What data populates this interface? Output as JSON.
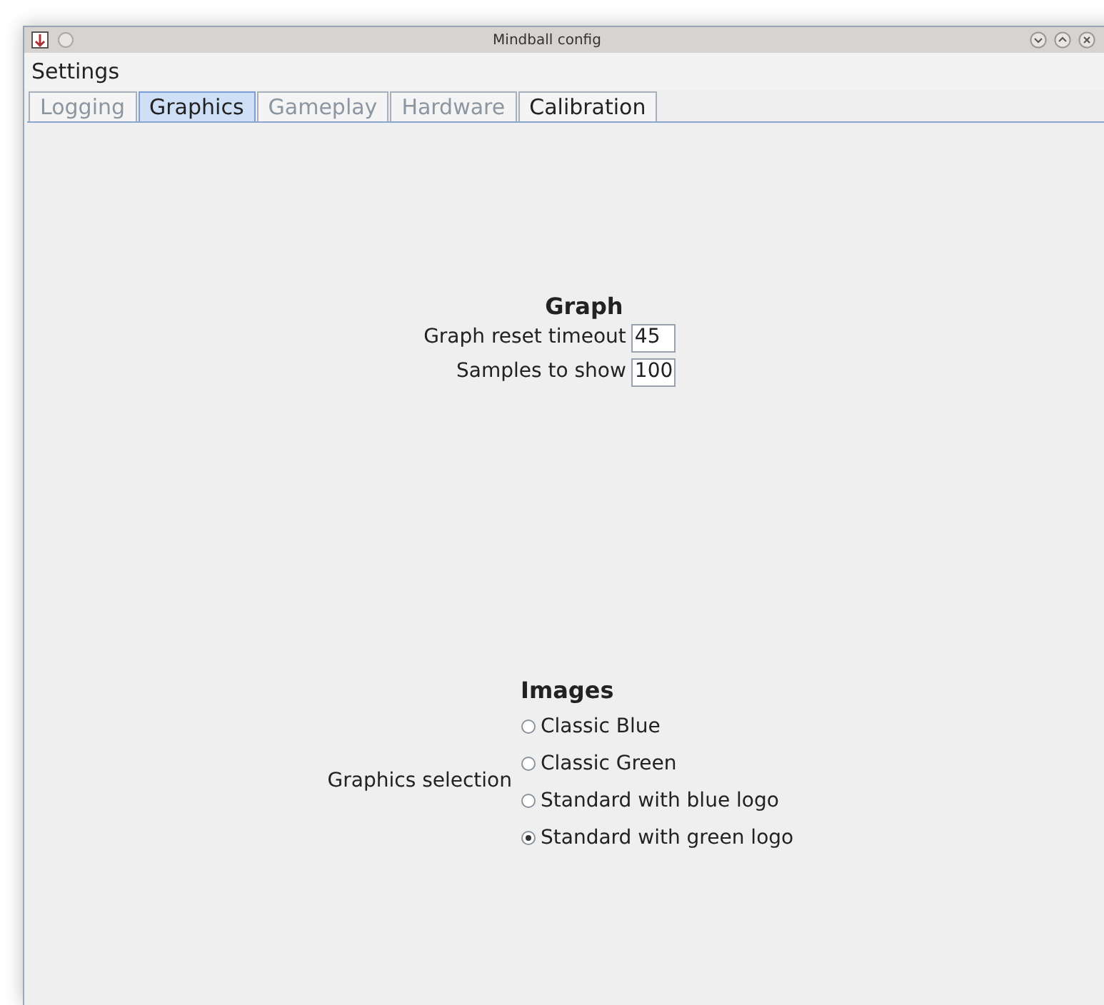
{
  "window": {
    "title": "Mindball config"
  },
  "menu": [
    "Settings"
  ],
  "tabs": [
    {
      "label": "Logging",
      "selected": false,
      "disabled": true
    },
    {
      "label": "Graphics",
      "selected": true,
      "disabled": false
    },
    {
      "label": "Gameplay",
      "selected": false,
      "disabled": true
    },
    {
      "label": "Hardware",
      "selected": false,
      "disabled": true
    },
    {
      "label": "Calibration",
      "selected": false,
      "disabled": false
    }
  ],
  "graph": {
    "heading": "Graph",
    "fields": [
      {
        "label": "Graph reset timeout",
        "value": "45"
      },
      {
        "label": "Samples to show",
        "value": "100"
      }
    ]
  },
  "images": {
    "heading": "Images",
    "label": "Graphics selection",
    "options": [
      {
        "label": "Classic Blue",
        "selected": false
      },
      {
        "label": "Classic Green",
        "selected": false
      },
      {
        "label": "Standard with blue logo",
        "selected": false
      },
      {
        "label": "Standard with green logo",
        "selected": true
      }
    ]
  }
}
